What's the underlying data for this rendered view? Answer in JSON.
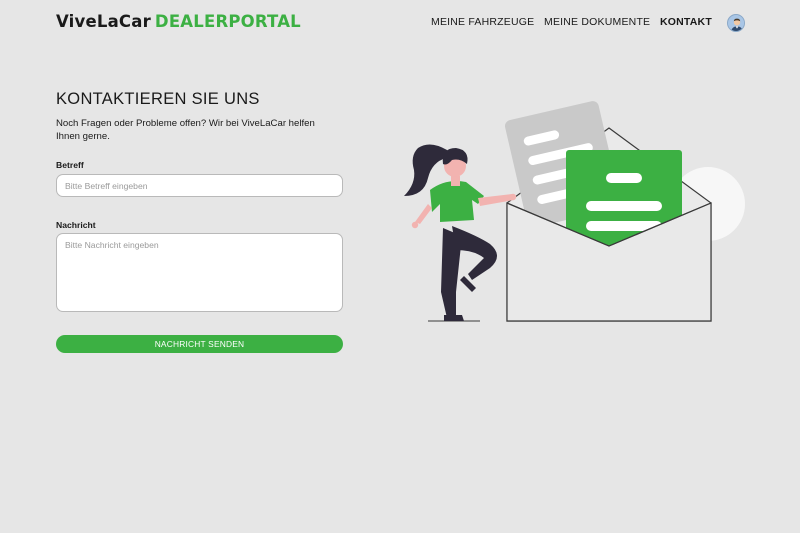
{
  "header": {
    "logo_brand": "ViveLaCar",
    "logo_portal": "DEALERPORTAL",
    "nav": [
      {
        "label": "MEINE FAHRZEUGE"
      },
      {
        "label": "MEINE DOKUMENTE"
      },
      {
        "label": "KONTAKT"
      }
    ],
    "avatar_icon": "user-avatar-icon"
  },
  "main": {
    "title": "KONTAKTIEREN SIE UNS",
    "subtitle": "Noch Fragen oder Probleme offen? Wir bei ViveLaCar helfen Ihnen gerne.",
    "betreff_label": "Betreff",
    "betreff_placeholder": "Bitte Betreff eingeben",
    "betreff_value": "",
    "nachricht_label": "Nachricht",
    "nachricht_placeholder": "Bitte Nachricht eingeben",
    "nachricht_value": "",
    "send_label": "NACHRICHT SENDEN"
  },
  "colors": {
    "accent": "#3cb043",
    "background": "#e6e6e6"
  },
  "illustration": {
    "name": "woman-with-envelope-illustration"
  }
}
